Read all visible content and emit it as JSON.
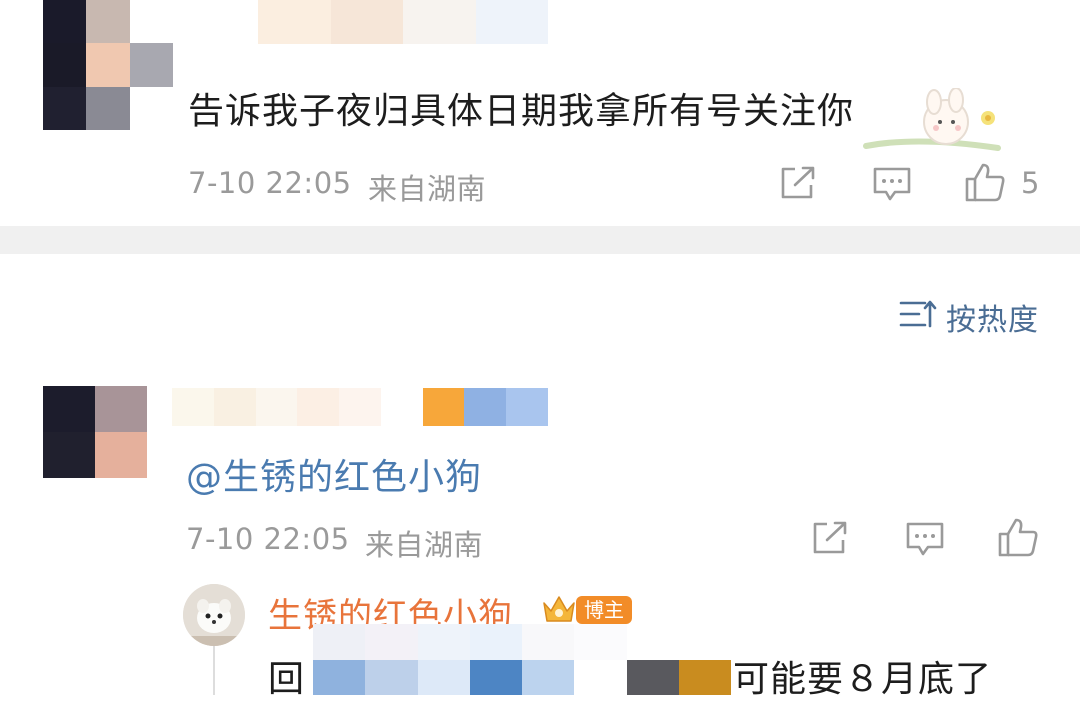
{
  "comment_top": {
    "text": "告诉我子夜归具体日期我拿所有号关注你",
    "time": "7-10 22:05",
    "location": "来自湖南",
    "like_count": "5"
  },
  "sort": {
    "label": "按热度"
  },
  "comment_second": {
    "mention": "@生锈的红色小狗",
    "time": "7-10 22:05",
    "location": "来自湖南"
  },
  "reply": {
    "author": "生锈的红色小狗",
    "badge": "博主",
    "prefix": "回",
    "text": "可能要８月底了"
  },
  "colors": {
    "mention_blue": "#4a7bb0",
    "author_orange": "#e8743b",
    "badge_orange": "#f28c28",
    "meta_gray": "#9a9a9a"
  }
}
